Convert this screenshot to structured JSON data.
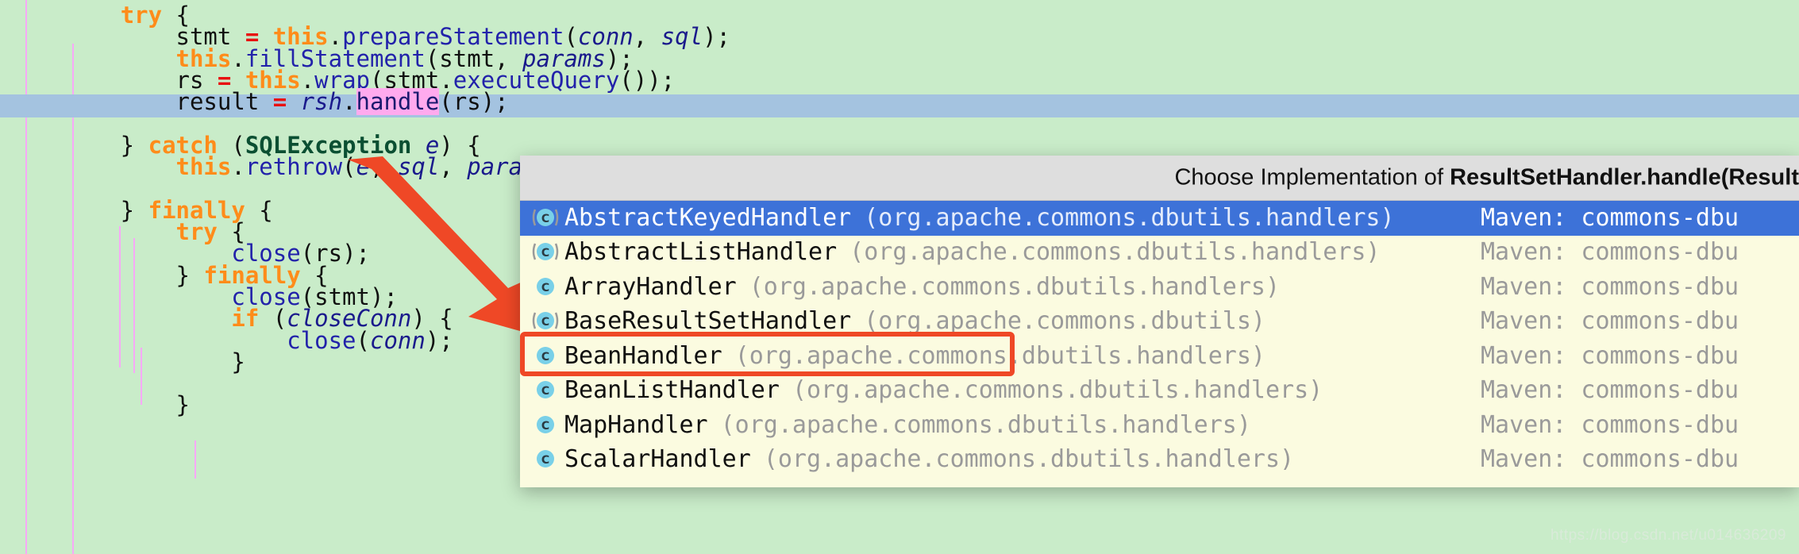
{
  "editor": {
    "background_color": "#c9ecc9",
    "current_line_color": "#a4c3e0",
    "indent_guide_color": "#f7a8f7",
    "lines": [
      {
        "indent": 0,
        "tokens": [
          {
            "t": "        ",
            "c": "plain"
          },
          {
            "t": "try",
            "c": "kw"
          },
          {
            "t": " {",
            "c": "brace"
          }
        ]
      },
      {
        "indent": 0,
        "tokens": [
          {
            "t": "            ",
            "c": "plain"
          },
          {
            "t": "stmt ",
            "c": "plain"
          },
          {
            "t": "=",
            "c": "op"
          },
          {
            "t": " ",
            "c": "plain"
          },
          {
            "t": "this",
            "c": "this"
          },
          {
            "t": ".",
            "c": "punct"
          },
          {
            "t": "prepareStatement",
            "c": "method"
          },
          {
            "t": "(",
            "c": "punct"
          },
          {
            "t": "conn",
            "c": "ital"
          },
          {
            "t": ", ",
            "c": "punct"
          },
          {
            "t": "sql",
            "c": "ital"
          },
          {
            "t": ");",
            "c": "punct"
          }
        ]
      },
      {
        "indent": 0,
        "tokens": [
          {
            "t": "            ",
            "c": "plain"
          },
          {
            "t": "this",
            "c": "this"
          },
          {
            "t": ".",
            "c": "punct"
          },
          {
            "t": "fillStatement",
            "c": "method"
          },
          {
            "t": "(",
            "c": "punct"
          },
          {
            "t": "stmt",
            "c": "plain"
          },
          {
            "t": ", ",
            "c": "punct"
          },
          {
            "t": "params",
            "c": "ital"
          },
          {
            "t": ");",
            "c": "punct"
          }
        ]
      },
      {
        "indent": 0,
        "tokens": [
          {
            "t": "            ",
            "c": "plain"
          },
          {
            "t": "rs ",
            "c": "plain"
          },
          {
            "t": "=",
            "c": "op"
          },
          {
            "t": " ",
            "c": "plain"
          },
          {
            "t": "this",
            "c": "this"
          },
          {
            "t": ".",
            "c": "punct"
          },
          {
            "t": "wrap",
            "c": "method"
          },
          {
            "t": "(",
            "c": "punct"
          },
          {
            "t": "stmt",
            "c": "plain"
          },
          {
            "t": ".",
            "c": "punct"
          },
          {
            "t": "executeQuery",
            "c": "method"
          },
          {
            "t": "());",
            "c": "punct"
          }
        ]
      },
      {
        "indent": 0,
        "highlight": true,
        "tokens": [
          {
            "t": "            ",
            "c": "plain"
          },
          {
            "t": "result ",
            "c": "plain"
          },
          {
            "t": "=",
            "c": "op"
          },
          {
            "t": " ",
            "c": "plain"
          },
          {
            "t": "rsh",
            "c": "ital"
          },
          {
            "t": ".",
            "c": "punct"
          },
          {
            "t": "handle",
            "c": "hl"
          },
          {
            "t": "(",
            "c": "punct"
          },
          {
            "t": "rs",
            "c": "plain"
          },
          {
            "t": ");",
            "c": "punct"
          }
        ]
      },
      {
        "indent": 0,
        "tokens": []
      },
      {
        "indent": 0,
        "tokens": [
          {
            "t": "        } ",
            "c": "brace"
          },
          {
            "t": "catch",
            "c": "kw"
          },
          {
            "t": " (",
            "c": "punct"
          },
          {
            "t": "SQLException",
            "c": "type"
          },
          {
            "t": " ",
            "c": "plain"
          },
          {
            "t": "e",
            "c": "ital"
          },
          {
            "t": ") {",
            "c": "punct"
          }
        ]
      },
      {
        "indent": 0,
        "tokens": [
          {
            "t": "            ",
            "c": "plain"
          },
          {
            "t": "this",
            "c": "this"
          },
          {
            "t": ".",
            "c": "punct"
          },
          {
            "t": "rethrow",
            "c": "method"
          },
          {
            "t": "(",
            "c": "punct"
          },
          {
            "t": "e",
            "c": "ital"
          },
          {
            "t": ", ",
            "c": "punct"
          },
          {
            "t": "sql",
            "c": "ital"
          },
          {
            "t": ", ",
            "c": "punct"
          },
          {
            "t": "params",
            "c": "ital"
          },
          {
            "t": ");",
            "c": "punct"
          }
        ]
      },
      {
        "indent": 0,
        "tokens": []
      },
      {
        "indent": 0,
        "tokens": [
          {
            "t": "        } ",
            "c": "brace"
          },
          {
            "t": "finally",
            "c": "kw"
          },
          {
            "t": " {",
            "c": "brace"
          }
        ]
      },
      {
        "indent": 0,
        "tokens": [
          {
            "t": "            ",
            "c": "plain"
          },
          {
            "t": "try",
            "c": "kw"
          },
          {
            "t": " {",
            "c": "brace"
          }
        ]
      },
      {
        "indent": 0,
        "tokens": [
          {
            "t": "                ",
            "c": "plain"
          },
          {
            "t": "close",
            "c": "method"
          },
          {
            "t": "(",
            "c": "punct"
          },
          {
            "t": "rs",
            "c": "plain"
          },
          {
            "t": ");",
            "c": "punct"
          }
        ]
      },
      {
        "indent": 0,
        "tokens": [
          {
            "t": "            } ",
            "c": "brace"
          },
          {
            "t": "finally",
            "c": "kw"
          },
          {
            "t": " {",
            "c": "brace"
          }
        ]
      },
      {
        "indent": 0,
        "tokens": [
          {
            "t": "                ",
            "c": "plain"
          },
          {
            "t": "close",
            "c": "method"
          },
          {
            "t": "(",
            "c": "punct"
          },
          {
            "t": "stmt",
            "c": "plain"
          },
          {
            "t": ");",
            "c": "punct"
          }
        ]
      },
      {
        "indent": 0,
        "tokens": [
          {
            "t": "                ",
            "c": "plain"
          },
          {
            "t": "if",
            "c": "kw"
          },
          {
            "t": " (",
            "c": "punct"
          },
          {
            "t": "closeConn",
            "c": "ital"
          },
          {
            "t": ") {",
            "c": "punct"
          }
        ]
      },
      {
        "indent": 0,
        "tokens": [
          {
            "t": "                    ",
            "c": "plain"
          },
          {
            "t": "close",
            "c": "method"
          },
          {
            "t": "(",
            "c": "punct"
          },
          {
            "t": "conn",
            "c": "ital"
          },
          {
            "t": ");",
            "c": "punct"
          }
        ]
      },
      {
        "indent": 0,
        "tokens": [
          {
            "t": "                }",
            "c": "brace"
          }
        ]
      },
      {
        "indent": 0,
        "tokens": []
      },
      {
        "indent": 0,
        "tokens": [
          {
            "t": "            }",
            "c": "brace"
          }
        ]
      }
    ]
  },
  "popup": {
    "title_prefix": "Choose Implementation of ",
    "title_bold": "ResultSetHandler.handle(Result",
    "header_bg": "#dedede",
    "body_bg": "#fbfbe0",
    "selected_bg": "#3d72d8",
    "items": [
      {
        "icon": "class-abstract-icon",
        "name": "AbstractKeyedHandler",
        "package": "(org.apache.commons.dbutils.handlers)",
        "maven": "Maven: commons-dbu",
        "selected": true,
        "abstract": true
      },
      {
        "icon": "class-abstract-icon",
        "name": "AbstractListHandler",
        "package": "(org.apache.commons.dbutils.handlers)",
        "maven": "Maven: commons-dbu",
        "selected": false,
        "abstract": true
      },
      {
        "icon": "class-icon",
        "name": "ArrayHandler",
        "package": "(org.apache.commons.dbutils.handlers)",
        "maven": "Maven: commons-dbu",
        "selected": false,
        "abstract": false
      },
      {
        "icon": "class-abstract-icon",
        "name": "BaseResultSetHandler",
        "package": "(org.apache.commons.dbutils)",
        "maven": "Maven: commons-dbu",
        "selected": false,
        "abstract": true
      },
      {
        "icon": "class-icon",
        "name": "BeanHandler",
        "package": "(org.apache.commons.dbutils.handlers)",
        "maven": "Maven: commons-dbu",
        "selected": false,
        "abstract": false
      },
      {
        "icon": "class-icon",
        "name": "BeanListHandler",
        "package": "(org.apache.commons.dbutils.handlers)",
        "maven": "Maven: commons-dbu",
        "selected": false,
        "abstract": false
      },
      {
        "icon": "class-icon",
        "name": "MapHandler",
        "package": "(org.apache.commons.dbutils.handlers)",
        "maven": "Maven: commons-dbu",
        "selected": false,
        "abstract": false
      },
      {
        "icon": "class-icon",
        "name": "ScalarHandler",
        "package": "(org.apache.commons.dbutils.handlers)",
        "maven": "Maven: commons-dbu",
        "selected": false,
        "abstract": false
      }
    ]
  },
  "annotations": {
    "arrow_color": "#ef4826",
    "highlight_box_color": "#ef4826",
    "highlight_box_target": "BeanHandler"
  },
  "watermark": {
    "text": "https://blog.csdn.net/u014636209"
  }
}
